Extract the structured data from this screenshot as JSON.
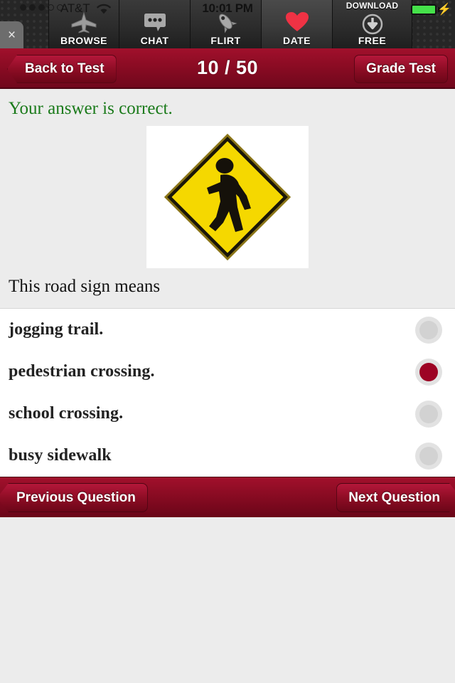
{
  "status_bar": {
    "signal_dots_filled": 3,
    "signal_dots_empty": 2,
    "carrier": "AT&T",
    "wifi_icon": "wifi-icon",
    "time": "10:01 PM",
    "battery_icon": "battery-charging-icon",
    "battery_color": "#45e14a"
  },
  "ad_banner": {
    "close_label": "×",
    "tabs": [
      {
        "label": "BROWSE",
        "icon": "airplane-icon",
        "active": false
      },
      {
        "label": "CHAT",
        "icon": "speech-bubble-icon",
        "active": false
      },
      {
        "label": "FLIRT",
        "icon": "rocket-icon",
        "active": false
      },
      {
        "label": "DATE",
        "icon": "heart-icon",
        "active": true
      },
      {
        "label": "FREE",
        "icon": "download-arrow-icon",
        "active": false,
        "top_label": "DOWNLOAD"
      }
    ]
  },
  "nav": {
    "back_label": "Back to Test",
    "title": "10 / 50",
    "grade_label": "Grade Test",
    "bar_color": "#8d0c24"
  },
  "main": {
    "feedback": "Your answer is correct.",
    "feedback_color": "#1a7a1a",
    "sign_icon": "pedestrian-crossing-sign",
    "question": "This road sign means",
    "options": [
      {
        "label": "jogging trail.",
        "selected": false
      },
      {
        "label": "pedestrian crossing.",
        "selected": true
      },
      {
        "label": "school crossing.",
        "selected": false
      },
      {
        "label": "busy sidewalk",
        "selected": false
      }
    ],
    "selected_color": "#9d0324"
  },
  "toolbar": {
    "previous_label": "Previous Question",
    "next_label": "Next Question"
  }
}
